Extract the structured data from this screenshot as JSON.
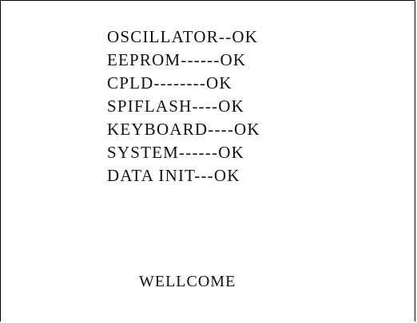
{
  "diagnostics": [
    "OSCILLATOR--OK",
    "EEPROM------OK",
    "CPLD--------OK",
    "SPIFLASH----OK",
    "KEYBOARD----OK",
    "SYSTEM------OK",
    "DATA INIT---OK"
  ],
  "welcome_text": "WELLCOME"
}
